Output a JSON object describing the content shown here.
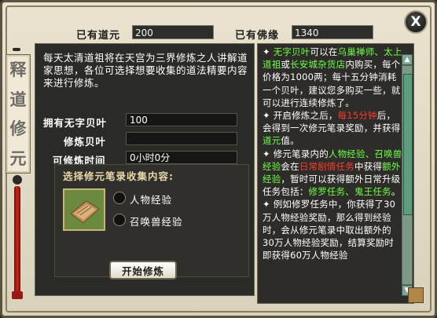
{
  "title": {
    "chars": [
      "释",
      "道",
      "修",
      "元"
    ]
  },
  "header": {
    "daoyuan_label": "已有道元",
    "daoyuan_value": "200",
    "foyuan_label": "已有佛缘",
    "foyuan_value": "1340"
  },
  "close_label": "X",
  "intro": "每天太清道祖将在天宫为三界修炼之人讲解道家思想，各位可选择想要收集的道法精要内容来进行修炼。",
  "form": {
    "owned_label": "拥有无字贝叶",
    "owned_value": "100",
    "cultivate_label": "修炼贝叶",
    "cultivate_value": "",
    "time_label": "可修炼时间",
    "time_value": "0小时0分"
  },
  "section": {
    "title": "选择修元笔录收集内容:",
    "options": [
      "人物经验",
      "召唤兽经验"
    ]
  },
  "start_button": "开始修炼",
  "help": {
    "p1_a": "无字贝叶",
    "p1_b": "可以在",
    "p1_c": "乌巢禅师、太上道祖",
    "p1_d": "或",
    "p1_e": "长安城杂货店",
    "p1_f": "内购买，每个价格为1000两；每十五分钟消耗一个贝叶，建议您多购买一些，就可以进行连续修炼了。",
    "p2_a": "开启修炼之后，",
    "p2_b": "每15分钟",
    "p2_c": "后，会得到一次修元笔录奖励，并获得",
    "p2_d": "道元",
    "p2_e": "值。",
    "p3_a": "修元笔录内的",
    "p3_b": "人物经验、召唤兽经验",
    "p3_c": "会在",
    "p3_d": "日常剧情任务",
    "p3_e": "中获得",
    "p3_f": "额外经验",
    "p3_g": "，暂时可以获得额外日常升级任务包括：",
    "p3_h": "修罗任务、鬼王任务",
    "p3_i": "。",
    "p4": "例如修罗任务中，你获得了30万人物经验奖励，那么得到经验时，会从修元笔录中取出额外的30万人物经验奖励，结算奖励时即获得60万人物经验"
  }
}
